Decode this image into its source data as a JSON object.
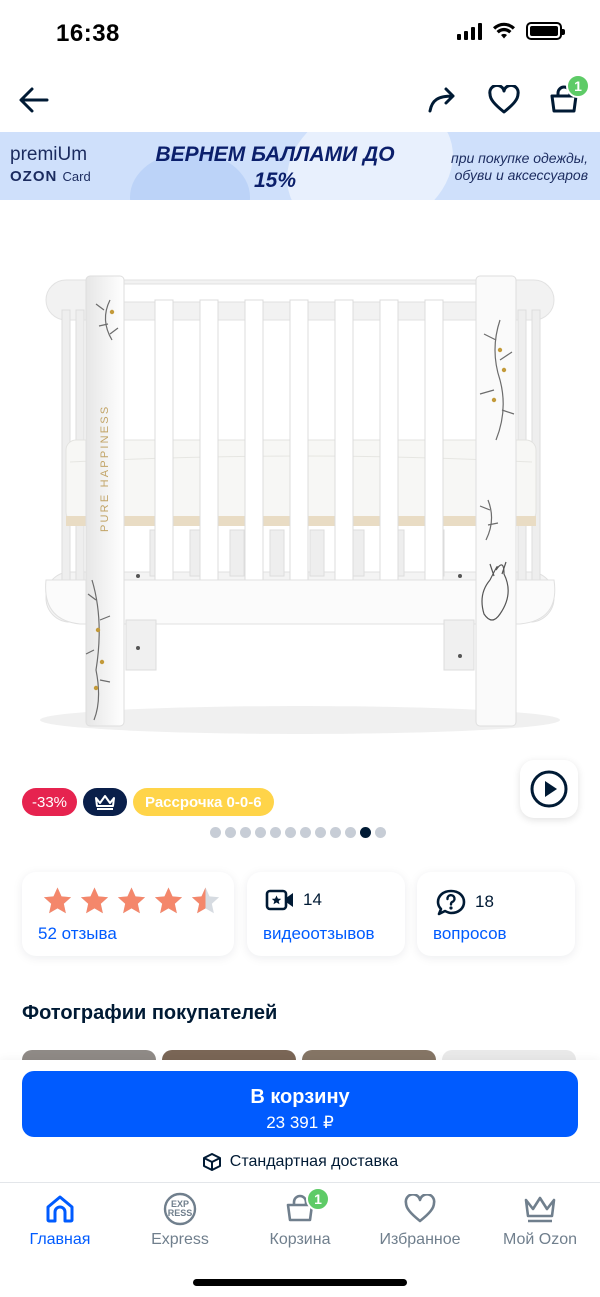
{
  "status_bar": {
    "time": "16:38"
  },
  "header": {
    "cart_count": "1"
  },
  "promo": {
    "brand_line1": "premiUm",
    "brand_line2": "OZON",
    "brand_line2_suffix": "Card",
    "headline": "ВЕРНЕМ БАЛЛАМИ ДО 15%",
    "subtext": "при покупке одежды, обуви и аксессуаров"
  },
  "product": {
    "image_text": "PURE HAPPINESS",
    "badges": {
      "discount": "-33%",
      "installment": "Рассрочка 0-0-6"
    },
    "gallery": {
      "total": 12,
      "active_index": 10
    }
  },
  "stats": {
    "rating": 4.5,
    "reviews": "52 отзыва",
    "video_count": "14",
    "video_label": "видеоотзывов",
    "questions_count": "18",
    "questions_label": "вопросов"
  },
  "customer_photos": {
    "title": "Фотографии покупателей"
  },
  "cta": {
    "label": "В корзину",
    "price": "23 391 ₽",
    "delivery": "Стандартная доставка"
  },
  "tab_bar": {
    "items": [
      {
        "label": "Главная",
        "icon": "home-icon",
        "active": true
      },
      {
        "label": "Express",
        "icon": "express-icon",
        "active": false
      },
      {
        "label": "Корзина",
        "icon": "cart-icon",
        "active": false,
        "badge": "1"
      },
      {
        "label": "Избранное",
        "icon": "heart-icon",
        "active": false
      },
      {
        "label": "Мой Ozon",
        "icon": "crown-icon",
        "active": false
      }
    ]
  },
  "colors": {
    "accent": "#005bff",
    "badge_green": "#5ecb67",
    "discount": "#e6234f",
    "installment": "#ffd449",
    "star": "#f4876b"
  }
}
